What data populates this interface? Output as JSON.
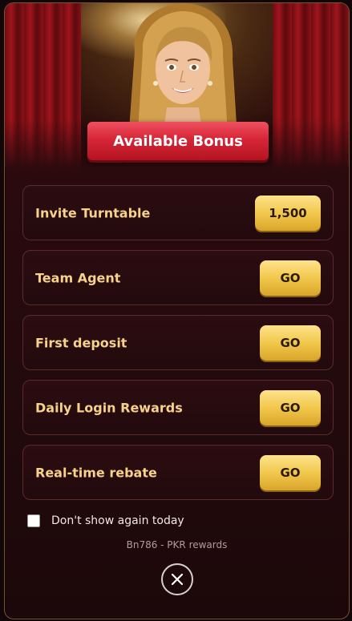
{
  "modal": {
    "title": "Available Bonus",
    "items": [
      {
        "label": "Invite Turntable",
        "button": "1,500"
      },
      {
        "label": "Team Agent",
        "button": "GO"
      },
      {
        "label": "First deposit",
        "button": "GO"
      },
      {
        "label": "Daily Login Rewards",
        "button": "GO"
      },
      {
        "label": "Real-time rebate",
        "button": "GO"
      }
    ],
    "checkbox_label": "Don't show again today",
    "checkbox_checked": false,
    "footer_note": "Bn786 - PKR rewards"
  },
  "colors": {
    "accent_gold": "#f2c84c",
    "banner_red": "#d62637",
    "label_gold": "#f7d28a",
    "background": "#2a0a0e"
  },
  "icons": {
    "close": "close-icon",
    "hero": "hostess-portrait"
  }
}
